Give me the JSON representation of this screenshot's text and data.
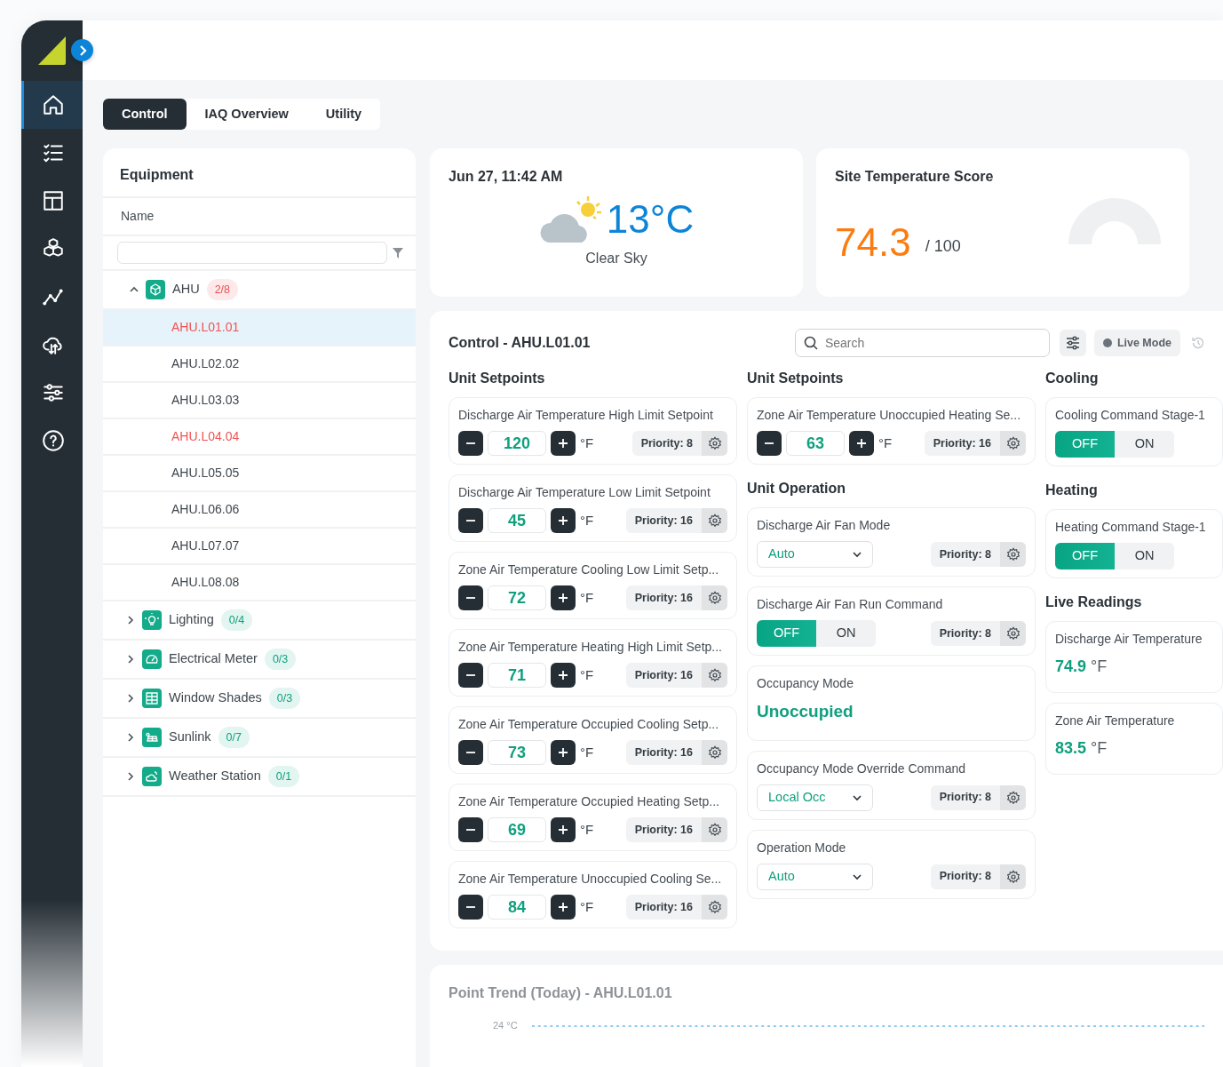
{
  "sidebar": {
    "items": [
      {
        "selected": true
      },
      {
        "selected": false
      },
      {
        "selected": false
      },
      {
        "selected": false
      },
      {
        "selected": false
      },
      {
        "selected": false
      },
      {
        "selected": false
      },
      {
        "selected": false
      }
    ]
  },
  "tabs": [
    {
      "label": "Control",
      "selected": true
    },
    {
      "label": "IAQ Overview",
      "selected": false
    },
    {
      "label": "Utility",
      "selected": false
    }
  ],
  "equipment": {
    "title": "Equipment",
    "column": "Name",
    "groups": [
      {
        "label": "AHU",
        "count": "2/8",
        "alarm": true,
        "expanded": true,
        "children": [
          {
            "label": "AHU.L01.01",
            "alarm": true,
            "selected": true
          },
          {
            "label": "AHU.L02.02",
            "alarm": false,
            "selected": false
          },
          {
            "label": "AHU.L03.03",
            "alarm": false,
            "selected": false
          },
          {
            "label": "AHU.L04.04",
            "alarm": true,
            "selected": false
          },
          {
            "label": "AHU.L05.05",
            "alarm": false,
            "selected": false
          },
          {
            "label": "AHU.L06.06",
            "alarm": false,
            "selected": false
          },
          {
            "label": "AHU.L07.07",
            "alarm": false,
            "selected": false
          },
          {
            "label": "AHU.L08.08",
            "alarm": false,
            "selected": false
          }
        ]
      },
      {
        "label": "Lighting",
        "count": "0/4",
        "alarm": false,
        "expanded": false
      },
      {
        "label": "Electrical Meter",
        "count": "0/3",
        "alarm": false,
        "expanded": false
      },
      {
        "label": "Window Shades",
        "count": "0/3",
        "alarm": false,
        "expanded": false
      },
      {
        "label": "Sunlink",
        "count": "0/7",
        "alarm": false,
        "expanded": false
      },
      {
        "label": "Weather Station",
        "count": "0/1",
        "alarm": false,
        "expanded": false
      }
    ]
  },
  "weather": {
    "datetime": "Jun 27, 11:42 AM",
    "temperature": "13°C",
    "condition": "Clear Sky"
  },
  "score": {
    "title": "Site Temperature Score",
    "value": "74.3",
    "max": "/ 100"
  },
  "control": {
    "title": "Control - AHU.L01.01",
    "search": {
      "placeholder": "Search"
    },
    "live_mode": {
      "label": "Live Mode",
      "on": false
    },
    "columns": [
      {
        "sections": [
          {
            "title": "Unit Setpoints",
            "cards": [
              {
                "kind": "setpoint",
                "label": "Discharge Air Temperature High Limit Setpoint",
                "value": "120",
                "unit": "°F",
                "priority": "Priority: 8"
              },
              {
                "kind": "setpoint",
                "label": "Discharge Air Temperature Low Limit Setpoint",
                "value": "45",
                "unit": "°F",
                "priority": "Priority: 16"
              },
              {
                "kind": "setpoint",
                "label": "Zone Air Temperature Cooling Low Limit Setp...",
                "value": "72",
                "unit": "°F",
                "priority": "Priority: 16"
              },
              {
                "kind": "setpoint",
                "label": "Zone Air Temperature Heating High Limit Setp...",
                "value": "71",
                "unit": "°F",
                "priority": "Priority: 16"
              },
              {
                "kind": "setpoint",
                "label": "Zone Air Temperature Occupied Cooling Setp...",
                "value": "73",
                "unit": "°F",
                "priority": "Priority: 16"
              },
              {
                "kind": "setpoint",
                "label": "Zone Air Temperature Occupied Heating Setp...",
                "value": "69",
                "unit": "°F",
                "priority": "Priority: 16"
              },
              {
                "kind": "setpoint",
                "label": "Zone Air Temperature Unoccupied Cooling Se...",
                "value": "84",
                "unit": "°F",
                "priority": "Priority: 16"
              }
            ]
          }
        ]
      },
      {
        "sections": [
          {
            "title": "Unit Setpoints",
            "cards": [
              {
                "kind": "setpoint",
                "label": "Zone Air Temperature Unoccupied Heating Se...",
                "value": "63",
                "unit": "°F",
                "priority": "Priority: 16"
              }
            ]
          },
          {
            "title": "Unit Operation",
            "cards": [
              {
                "kind": "select",
                "label": "Discharge Air Fan Mode",
                "value": "Auto",
                "priority": "Priority: 8"
              },
              {
                "kind": "toggle",
                "label": "Discharge Air Fan Run Command",
                "options": [
                  {
                    "label": "OFF",
                    "selected": true
                  },
                  {
                    "label": "ON",
                    "selected": false
                  }
                ],
                "priority": "Priority: 8"
              },
              {
                "kind": "status",
                "label": "Occupancy Mode",
                "value": "Unoccupied"
              },
              {
                "kind": "select",
                "label": "Occupancy Mode Override Command",
                "value": "Local Occ",
                "priority": "Priority: 8"
              },
              {
                "kind": "select",
                "label": "Operation Mode",
                "value": "Auto",
                "priority": "Priority: 8"
              }
            ]
          }
        ]
      },
      {
        "sections": [
          {
            "title": "Cooling",
            "cards": [
              {
                "kind": "toggle",
                "label": "Cooling Command Stage-1",
                "options": [
                  {
                    "label": "OFF",
                    "selected": true
                  },
                  {
                    "label": "ON",
                    "selected": false
                  }
                ]
              }
            ]
          },
          {
            "title": "Heating",
            "cards": [
              {
                "kind": "toggle",
                "label": "Heating Command Stage-1",
                "options": [
                  {
                    "label": "OFF",
                    "selected": true
                  },
                  {
                    "label": "ON",
                    "selected": false
                  }
                ]
              }
            ]
          },
          {
            "title": "Live Readings",
            "cards": [
              {
                "kind": "reading",
                "label": "Discharge Air Temperature",
                "value": "74.9",
                "unit": "°F"
              },
              {
                "kind": "reading",
                "label": "Zone Air Temperature",
                "value": "83.5",
                "unit": "°F"
              }
            ]
          }
        ]
      }
    ]
  },
  "trend": {
    "title": "Point Trend (Today) - AHU.L01.01",
    "y_tick": "24 °C"
  }
}
